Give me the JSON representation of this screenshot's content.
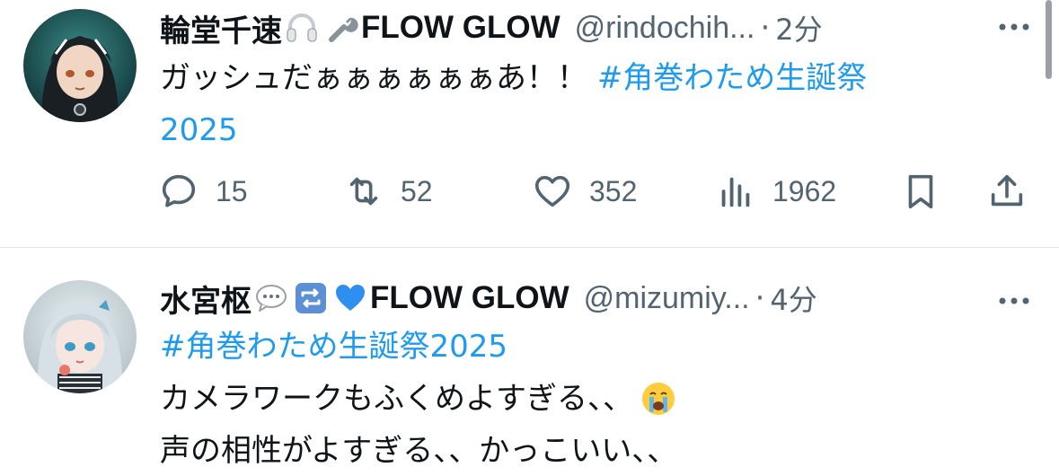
{
  "tweets": [
    {
      "display_name": "輪堂千速",
      "brand": "FLOW GLOW",
      "handle": "@rindochih...",
      "separator": "·",
      "time": "2分",
      "text_plain": "ガッシュだぁぁぁぁぁぁあ！！ ",
      "hashtag": "#角巻わため生誕祭",
      "hashtag_cont": "2025",
      "emojis": [
        "headphones-emoji",
        "wrench-emoji"
      ],
      "actions": {
        "replies": "15",
        "reposts": "52",
        "likes": "352",
        "views": "1962"
      }
    },
    {
      "display_name": "水宮枢",
      "brand": "FLOW GLOW",
      "handle": "@mizumiy...",
      "separator": "·",
      "time": "4分",
      "hashtag": "#角巻わため生誕祭2025",
      "line2": "カメラワークもふくめよすぎる、、",
      "line3": "声の相性がよすぎる、、かっこいい、、",
      "emojis": [
        "speech-bubble-emoji",
        "repeat-emoji",
        "blue-heart-emoji",
        "crying-face-emoji"
      ]
    }
  ],
  "colors": {
    "text": "#0f1419",
    "secondary": "#536471",
    "link": "#1d9bf0",
    "divider": "#e6e6e6"
  }
}
